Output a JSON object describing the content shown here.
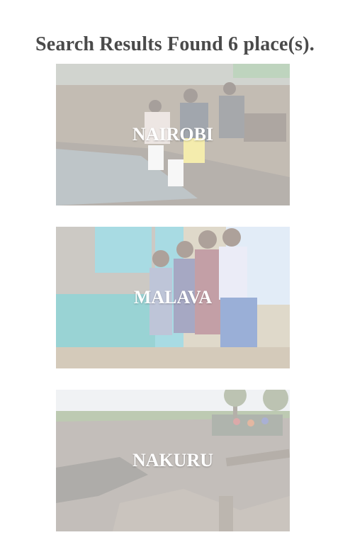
{
  "header": {
    "title": "Search Results Found 6 place(s)."
  },
  "results": [
    {
      "name": "NAIROBI"
    },
    {
      "name": "MALAVA"
    },
    {
      "name": "NAKURU"
    }
  ]
}
